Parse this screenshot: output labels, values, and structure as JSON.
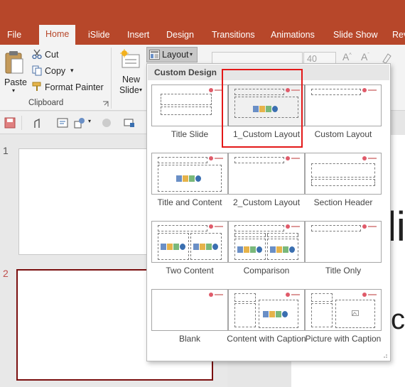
{
  "tabs": [
    "File",
    "Home",
    "iSlide",
    "Insert",
    "Design",
    "Transitions",
    "Animations",
    "Slide Show",
    "Rev"
  ],
  "active_tab": "Home",
  "ribbon": {
    "clipboard": {
      "paste": "Paste",
      "cut": "Cut",
      "copy": "Copy",
      "format_painter": "Format Painter",
      "label": "Clipboard"
    },
    "new_slide_line1": "New",
    "new_slide_line2": "Slide",
    "layout_button": "Layout",
    "font_size": "40"
  },
  "slides": {
    "numbers": [
      "1",
      "2"
    ],
    "partial_title_text": "li",
    "partial_text_2": "cl"
  },
  "layout_menu": {
    "header": "Custom Design",
    "layouts": [
      "Title Slide",
      "1_Custom Layout",
      "Custom Layout",
      "Title and Content",
      "2_Custom Layout",
      "Section Header",
      "Two Content",
      "Comparison",
      "Title Only",
      "Blank",
      "Content with Caption",
      "Picture with Caption"
    ],
    "selected": "1_Custom Layout"
  },
  "colors": {
    "accent": "#b7472a",
    "selection_outline": "#e31818",
    "selected_slide_border": "#7a0f0f"
  }
}
